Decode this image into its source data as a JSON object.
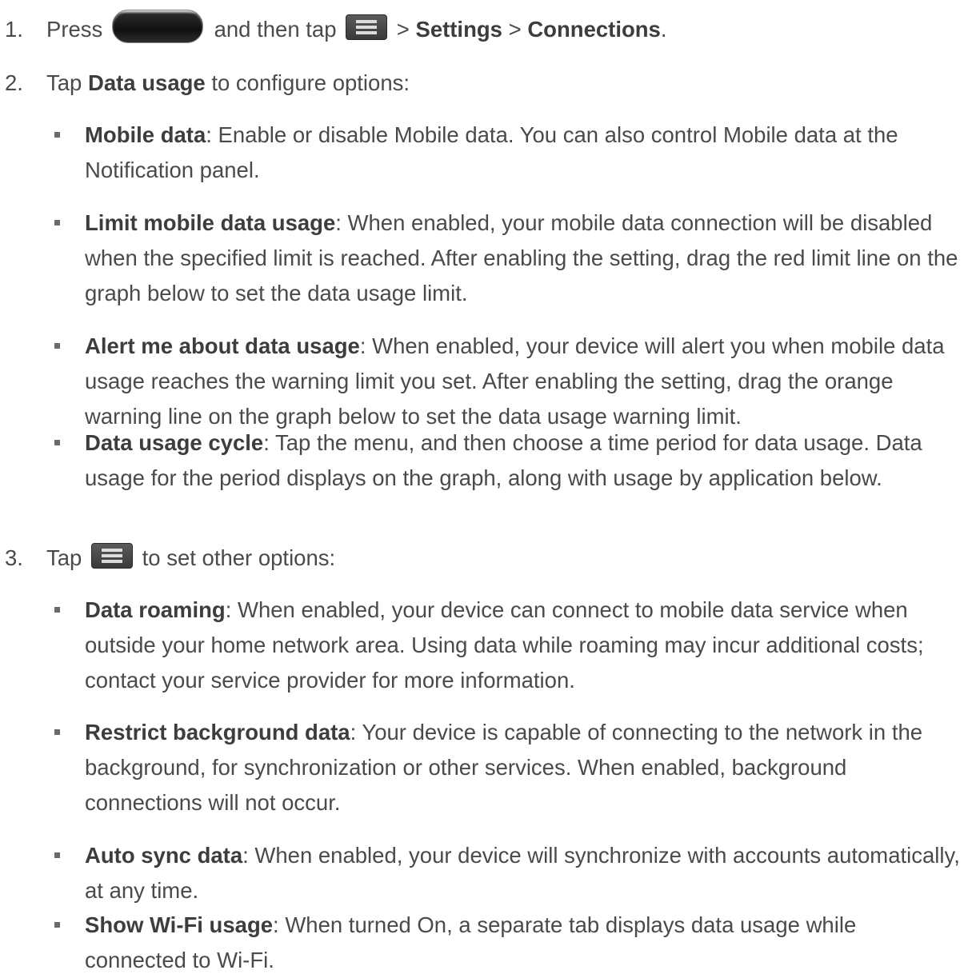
{
  "steps": [
    {
      "num": "1.",
      "press": "Press",
      "then_tap": "and then tap",
      "sep1": ">",
      "settings": "Settings",
      "sep2": ">",
      "connections": "Connections",
      "end": "."
    },
    {
      "num": "2.",
      "tap": "Tap",
      "data_usage": "Data usage",
      "rest": "to configure options:"
    },
    {
      "num": "3.",
      "tap": "Tap",
      "rest": "to set other options:"
    }
  ],
  "step2_items": [
    {
      "term": "Mobile data",
      "desc": ": Enable or disable Mobile data. You can also control Mobile data at the Notification panel."
    },
    {
      "term": "Limit mobile data usage",
      "desc": ": When enabled, your mobile data connection will be disabled when the specified limit is reached. After enabling the setting, drag the red limit line on the graph below to set the data usage limit."
    },
    {
      "term": "Alert me about data usage",
      "desc": ": When enabled, your device will alert you when mobile data usage reaches the warning limit you set. After enabling the setting, drag the orange warning line on the graph below to set the data usage warning limit."
    },
    {
      "term": "Data usage cycle",
      "desc": ": Tap the menu, and then choose a time period for data usage. Data usage for the period displays on the graph, along with usage by application below."
    }
  ],
  "step3_items": [
    {
      "term": "Data roaming",
      "desc": ": When enabled, your device can connect to mobile data service when outside your home network area. Using data while roaming may incur additional costs; contact your service provider for more information."
    },
    {
      "term": "Restrict background data",
      "desc": ": Your device is capable of connecting to the network in the background, for synchronization or other services. When enabled, background connections will not occur."
    },
    {
      "term": "Auto sync data",
      "desc": ": When enabled, your device will synchronize with accounts automatically, at any time."
    },
    {
      "term": "Show Wi-Fi usage",
      "desc": ": When turned On, a separate tab displays data usage while connected to Wi-Fi."
    }
  ],
  "icons": {
    "home_key": "home-key-icon",
    "menu_key": "menu-key-icon"
  }
}
